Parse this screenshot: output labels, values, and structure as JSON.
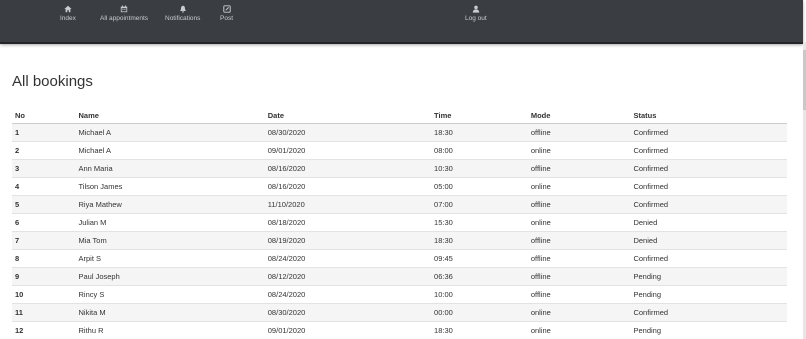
{
  "nav": {
    "items": [
      {
        "label": "Index",
        "icon": "home-icon"
      },
      {
        "label": "All appointments",
        "icon": "calendar-icon"
      },
      {
        "label": "Notifications",
        "icon": "bell-icon"
      },
      {
        "label": "Post",
        "icon": "post-icon"
      }
    ],
    "logout": {
      "label": "Log out",
      "icon": "user-icon"
    }
  },
  "page": {
    "title": "All bookings"
  },
  "table": {
    "headers": [
      "No",
      "Name",
      "Date",
      "Time",
      "Mode",
      "Status"
    ],
    "rows": [
      [
        "1",
        "Michael A",
        "08/30/2020",
        "18:30",
        "offline",
        "Confirmed"
      ],
      [
        "2",
        "Michael A",
        "09/01/2020",
        "08:00",
        "online",
        "Confirmed"
      ],
      [
        "3",
        "Ann Maria",
        "08/16/2020",
        "10:30",
        "offline",
        "Confirmed"
      ],
      [
        "4",
        "Tilson James",
        "08/16/2020",
        "05:00",
        "online",
        "Confirmed"
      ],
      [
        "5",
        "Riya Mathew",
        "11/10/2020",
        "07:00",
        "offline",
        "Confirmed"
      ],
      [
        "6",
        "Julian M",
        "08/18/2020",
        "15:30",
        "online",
        "Denied"
      ],
      [
        "7",
        "Mia Tom",
        "08/19/2020",
        "18:30",
        "offline",
        "Denied"
      ],
      [
        "8",
        "Arpit S",
        "08/24/2020",
        "09:45",
        "offline",
        "Confirmed"
      ],
      [
        "9",
        "Paul Joseph",
        "08/12/2020",
        "06:36",
        "offline",
        "Pending"
      ],
      [
        "10",
        "Rincy S",
        "08/24/2020",
        "10:00",
        "offline",
        "Pending"
      ],
      [
        "11",
        "Nikita M",
        "08/30/2020",
        "00:00",
        "online",
        "Confirmed"
      ],
      [
        "12",
        "Rithu R",
        "09/01/2020",
        "18:30",
        "online",
        "Pending"
      ]
    ]
  },
  "colors": {
    "navbar": "#3a3d42",
    "nav_text": "#c9ccd1",
    "row_stripe": "#f5f5f5"
  }
}
